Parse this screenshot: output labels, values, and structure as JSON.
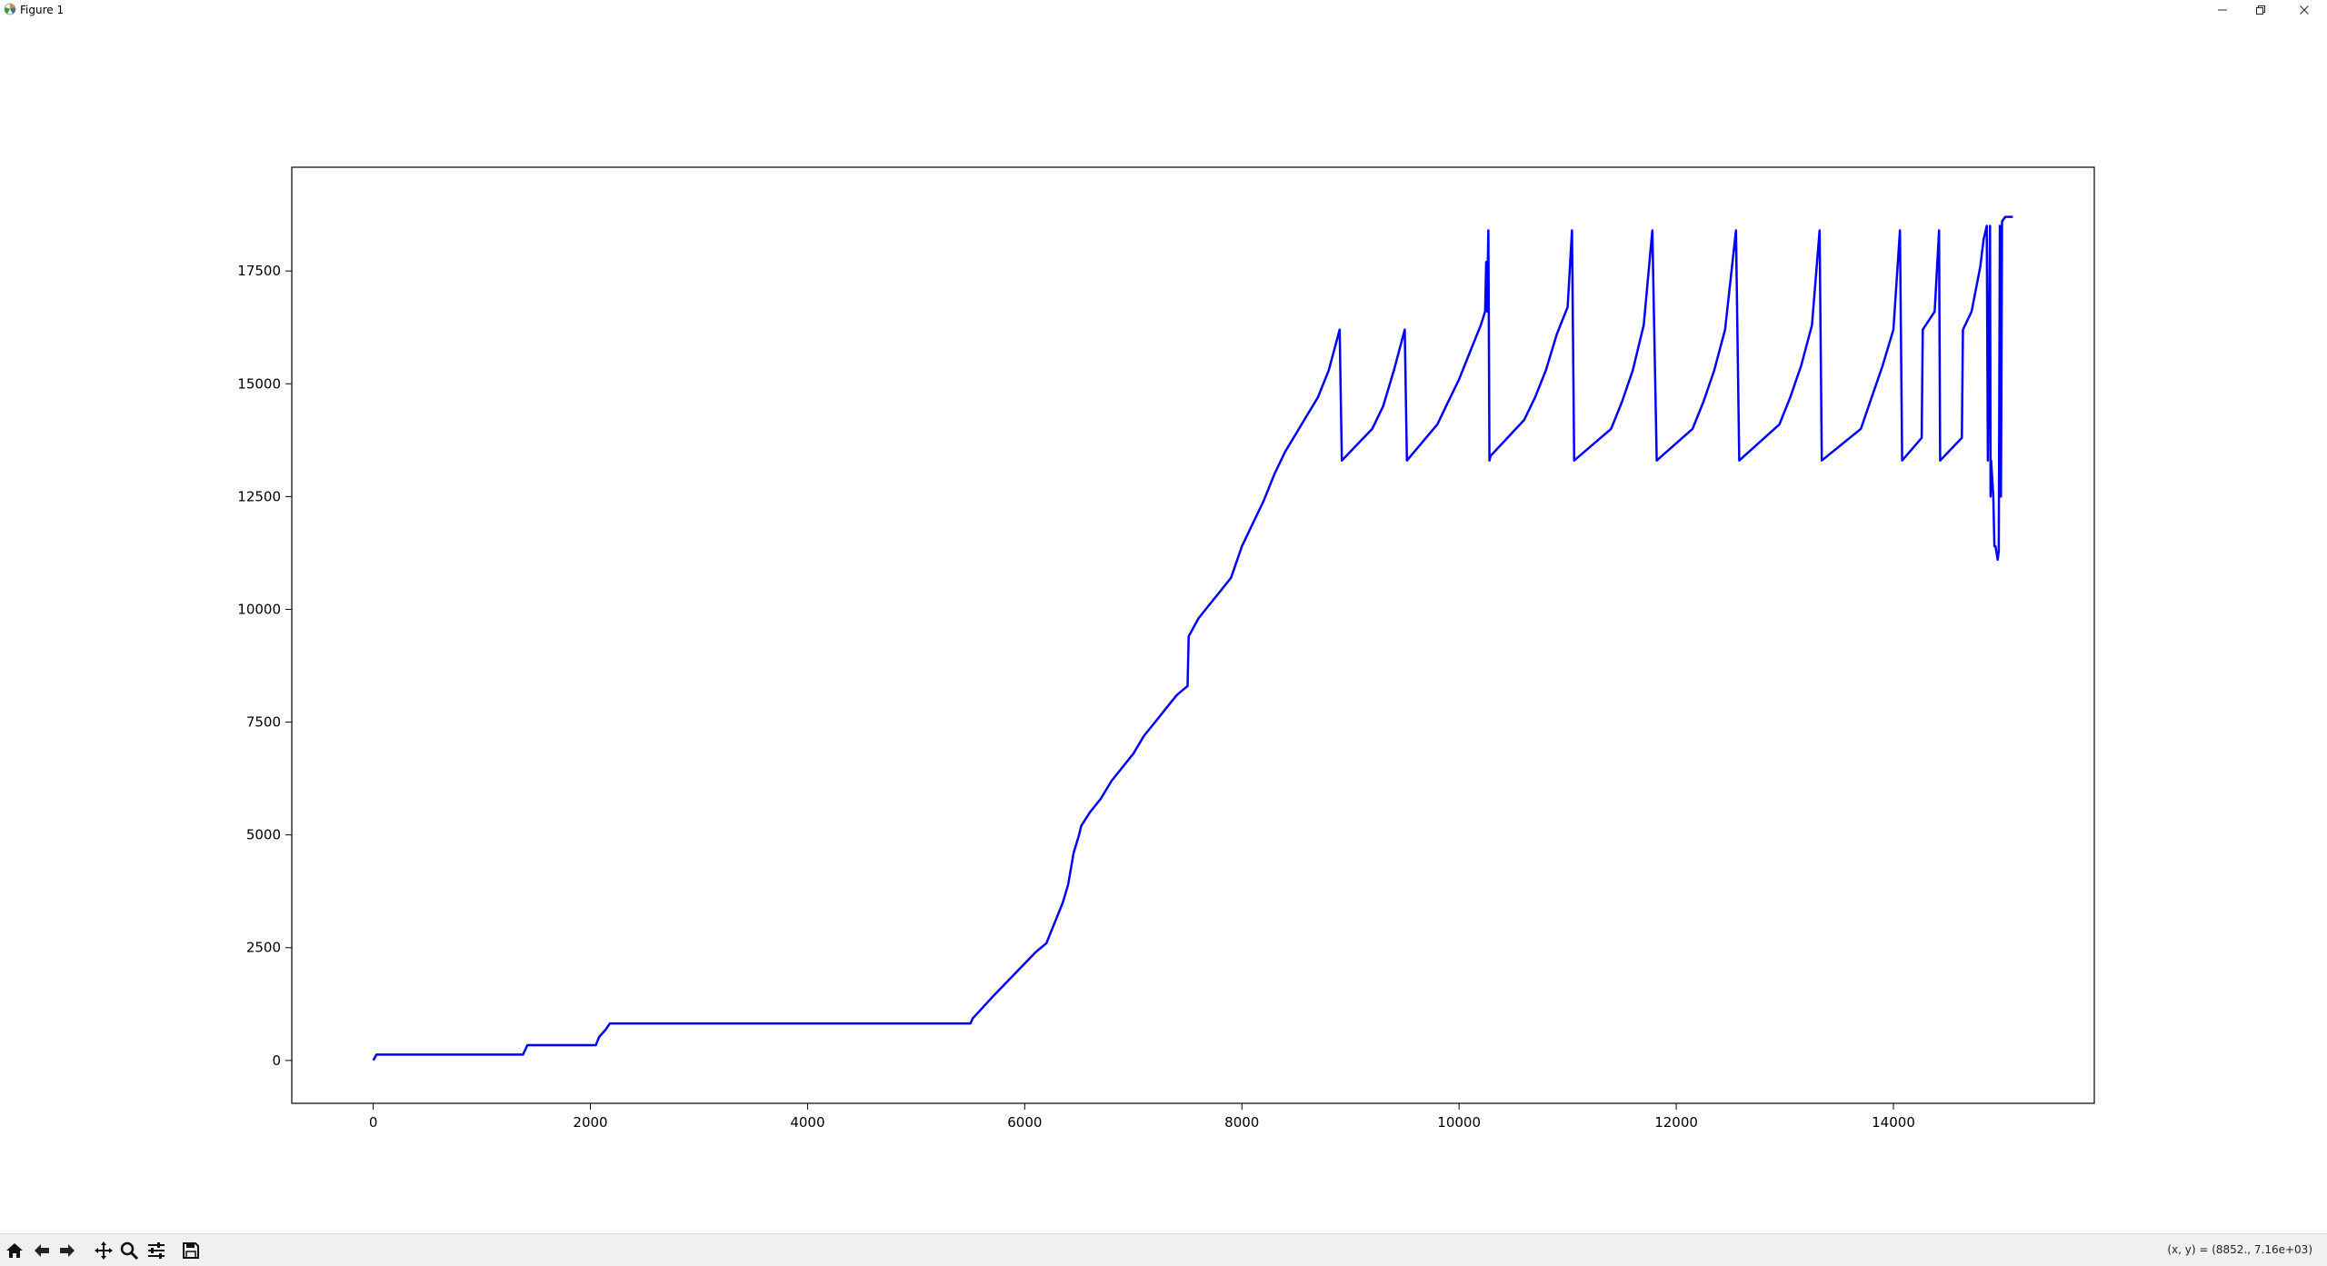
{
  "window": {
    "title": "Figure 1",
    "icons": {
      "app": "matplotlib-icon",
      "minimize": "minimize-icon",
      "maximize": "restore-icon",
      "close": "close-icon"
    }
  },
  "toolbar": {
    "tools": [
      "home-icon",
      "back-icon",
      "forward-icon",
      "pan-icon",
      "zoom-icon",
      "configure-subplots-icon",
      "save-icon"
    ],
    "coord_text": "(x, y) = (8852., 7.16e+03)"
  },
  "chart_data": {
    "type": "line",
    "xlim": [
      -750,
      15850
    ],
    "ylim": [
      -950,
      19800
    ],
    "xticks": [
      0,
      2000,
      4000,
      6000,
      8000,
      10000,
      12000,
      14000
    ],
    "yticks": [
      0,
      2500,
      5000,
      7500,
      10000,
      12500,
      15000,
      17500
    ],
    "xtick_labels": [
      "0",
      "2000",
      "4000",
      "6000",
      "8000",
      "10000",
      "12000",
      "14000"
    ],
    "ytick_labels": [
      "0",
      "2500",
      "5000",
      "7500",
      "10000",
      "12500",
      "15000",
      "17500"
    ],
    "grid": false,
    "series": [
      {
        "color": "#0000ff",
        "x": [
          0,
          30,
          1380,
          1420,
          2050,
          2080,
          2140,
          2180,
          5500,
          5520,
          5700,
          5900,
          6100,
          6200,
          6250,
          6350,
          6400,
          6450,
          6500,
          6520,
          6600,
          6700,
          6800,
          6900,
          7000,
          7100,
          7200,
          7300,
          7400,
          7500,
          7510,
          7600,
          7700,
          7800,
          7900,
          8000,
          8100,
          8200,
          8300,
          8400,
          8500,
          8600,
          8700,
          8800,
          8900,
          8920,
          9200,
          9300,
          9400,
          9500,
          9520,
          9800,
          9900,
          10000,
          10100,
          10200,
          10240,
          10250,
          10260,
          10265,
          10270,
          10280,
          10290,
          10600,
          10700,
          10800,
          10900,
          11000,
          11040,
          11060,
          11400,
          11500,
          11600,
          11700,
          11780,
          11820,
          12150,
          12250,
          12350,
          12450,
          12550,
          12580,
          12950,
          13050,
          13150,
          13250,
          13320,
          13340,
          13700,
          13800,
          13900,
          14000,
          14060,
          14080,
          14260,
          14270,
          14380,
          14420,
          14430,
          14630,
          14640,
          14720,
          14800,
          14830,
          14860,
          14870,
          14890,
          14895,
          14900,
          14920,
          14930,
          14940,
          14960,
          14970,
          14980,
          14990,
          15000,
          15030,
          15100
        ],
        "y": [
          0,
          130,
          130,
          340,
          340,
          520,
          680,
          820,
          820,
          930,
          1400,
          1900,
          2400,
          2600,
          2900,
          3500,
          3900,
          4600,
          5000,
          5200,
          5500,
          5800,
          6200,
          6500,
          6800,
          7200,
          7500,
          7800,
          8100,
          8300,
          9400,
          9800,
          10100,
          10400,
          10700,
          11400,
          11900,
          12400,
          13000,
          13500,
          13900,
          14300,
          14700,
          15300,
          16200,
          13300,
          14000,
          14500,
          15300,
          16200,
          13300,
          14100,
          14600,
          15100,
          15700,
          16300,
          16600,
          17700,
          16600,
          17700,
          18400,
          13300,
          13400,
          14200,
          14700,
          15300,
          16100,
          16700,
          18400,
          13300,
          14000,
          14600,
          15300,
          16300,
          18400,
          13300,
          14000,
          14600,
          15300,
          16200,
          18400,
          13300,
          14100,
          14700,
          15400,
          16300,
          18400,
          13300,
          14000,
          14700,
          15400,
          16200,
          18400,
          13300,
          13800,
          16200,
          16600,
          18400,
          13300,
          13800,
          16200,
          16600,
          17600,
          18200,
          18500,
          13300,
          18500,
          12500,
          13300,
          12500,
          11400,
          11400,
          11100,
          11300,
          18500,
          12500,
          18600,
          18700,
          18700
        ]
      }
    ]
  }
}
